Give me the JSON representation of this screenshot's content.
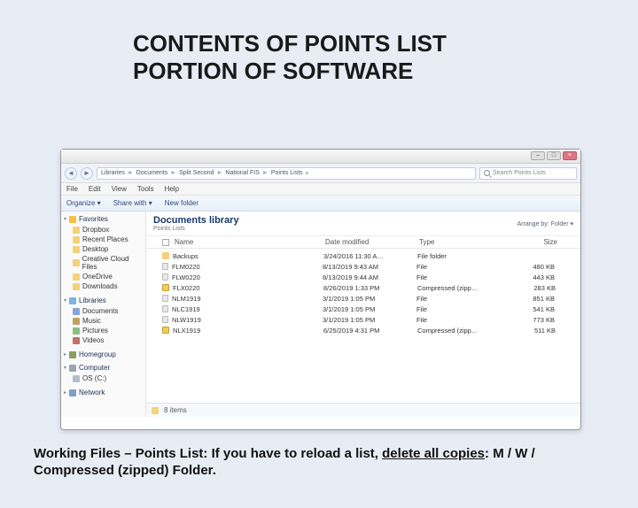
{
  "slide": {
    "title_line1": "CONTENTS OF POINTS LIST",
    "title_line2": "PORTION OF SOFTWARE"
  },
  "explorer": {
    "breadcrumbs": [
      "Libraries",
      "Documents",
      "Split Second",
      "National FIS",
      "Points Lists"
    ],
    "search_placeholder": "Search Points Lists",
    "menu": [
      "File",
      "Edit",
      "View",
      "Tools",
      "Help"
    ],
    "toolbar": [
      "Organize ▾",
      "Share with ▾",
      "New folder"
    ],
    "lib_title": "Documents library",
    "lib_sub": "Points Lists",
    "arrange": "Arrange by:  Folder ▾",
    "columns": {
      "name": "Name",
      "date": "Date modified",
      "type": "Type",
      "size": "Size"
    },
    "files": [
      {
        "name": "Backups",
        "date": "3/24/2016 11:30 A…",
        "type": "File folder",
        "size": "",
        "icon": "folder"
      },
      {
        "name": "FLM0220",
        "date": "8/13/2019 9:43 AM",
        "type": "File",
        "size": "480 KB",
        "icon": "file"
      },
      {
        "name": "FLW0220",
        "date": "8/13/2019 9:44 AM",
        "type": "File",
        "size": "443 KB",
        "icon": "file"
      },
      {
        "name": "FLX0220",
        "date": "8/26/2019 1:33 PM",
        "type": "Compressed (zipp…",
        "size": "283 KB",
        "icon": "zip"
      },
      {
        "name": "NLM1919",
        "date": "3/1/2019 1:05 PM",
        "type": "File",
        "size": "851 KB",
        "icon": "file"
      },
      {
        "name": "NLC1919",
        "date": "3/1/2019 1:05 PM",
        "type": "File",
        "size": "541 KB",
        "icon": "file"
      },
      {
        "name": "NLW1919",
        "date": "3/1/2019 1:05 PM",
        "type": "File",
        "size": "773 KB",
        "icon": "file"
      },
      {
        "name": "NLX1919",
        "date": "6/25/2019 4:31 PM",
        "type": "Compressed (zipp…",
        "size": "511 KB",
        "icon": "zip"
      }
    ],
    "details_items": "8 items",
    "nav": {
      "favorites": {
        "label": "Favorites",
        "items": [
          "Dropbox",
          "Recent Places",
          "Desktop",
          "Creative Cloud Files",
          "OneDrive",
          "Downloads"
        ]
      },
      "libraries": {
        "label": "Libraries",
        "items": [
          "Documents",
          "Music",
          "Pictures",
          "Videos"
        ]
      },
      "homegroup": {
        "label": "Homegroup"
      },
      "computer": {
        "label": "Computer",
        "items": [
          "OS (C:)"
        ]
      },
      "network": {
        "label": "Network"
      }
    }
  },
  "caption": {
    "lead": "Working Files – Points List:",
    "rest1": "  If you have to reload a list, ",
    "underline": "delete all copies",
    "rest2": ": M / W / Compressed (zipped) Folder."
  }
}
